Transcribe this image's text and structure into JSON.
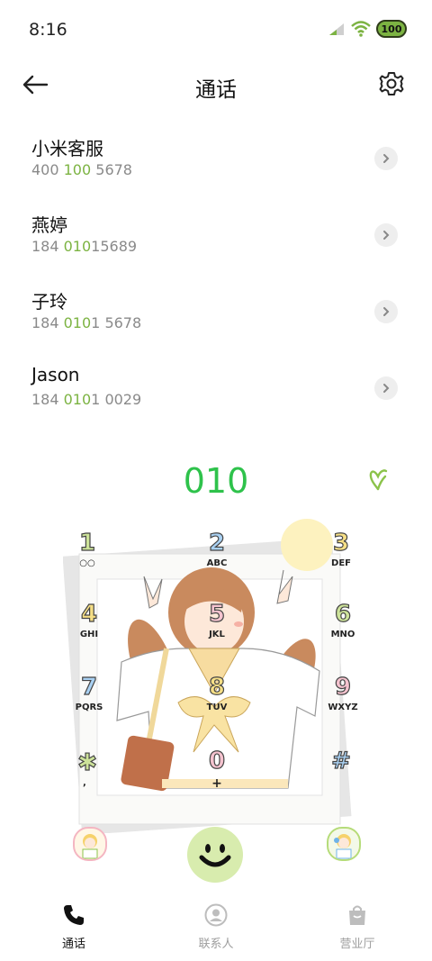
{
  "status": {
    "time": "8:16",
    "battery": "100"
  },
  "header": {
    "title": "通话"
  },
  "contacts": [
    {
      "name": "小米客服",
      "num_a": "400 ",
      "num_hl": "100",
      "num_b": " 5678"
    },
    {
      "name": "燕婷",
      "num_a": "184 ",
      "num_hl": "010",
      "num_b": "15689"
    },
    {
      "name": "子玲",
      "num_a": "184 ",
      "num_hl": "010",
      "num_b": "1 5678"
    },
    {
      "name": "Jason",
      "num_a": "184 ",
      "num_hl": "010",
      "num_b": "1 0029"
    }
  ],
  "dialer": {
    "input": "010",
    "keys": [
      {
        "digit": "1",
        "letters": "○○"
      },
      {
        "digit": "2",
        "letters": "ABC"
      },
      {
        "digit": "3",
        "letters": "DEF"
      },
      {
        "digit": "4",
        "letters": "GHI"
      },
      {
        "digit": "5",
        "letters": "JKL"
      },
      {
        "digit": "6",
        "letters": "MNO"
      },
      {
        "digit": "7",
        "letters": "PQRS"
      },
      {
        "digit": "8",
        "letters": "TUV"
      },
      {
        "digit": "9",
        "letters": "WXYZ"
      },
      {
        "digit": "✱",
        "letters": ","
      },
      {
        "digit": "0",
        "letters": "+"
      },
      {
        "digit": "#",
        "letters": ""
      }
    ]
  },
  "tabs": [
    {
      "label": "通话"
    },
    {
      "label": "联系人"
    },
    {
      "label": "营业厅"
    }
  ],
  "colors": {
    "accent": "#2ec24b",
    "highlight": "#7cb342",
    "call": "#d8ecae"
  }
}
